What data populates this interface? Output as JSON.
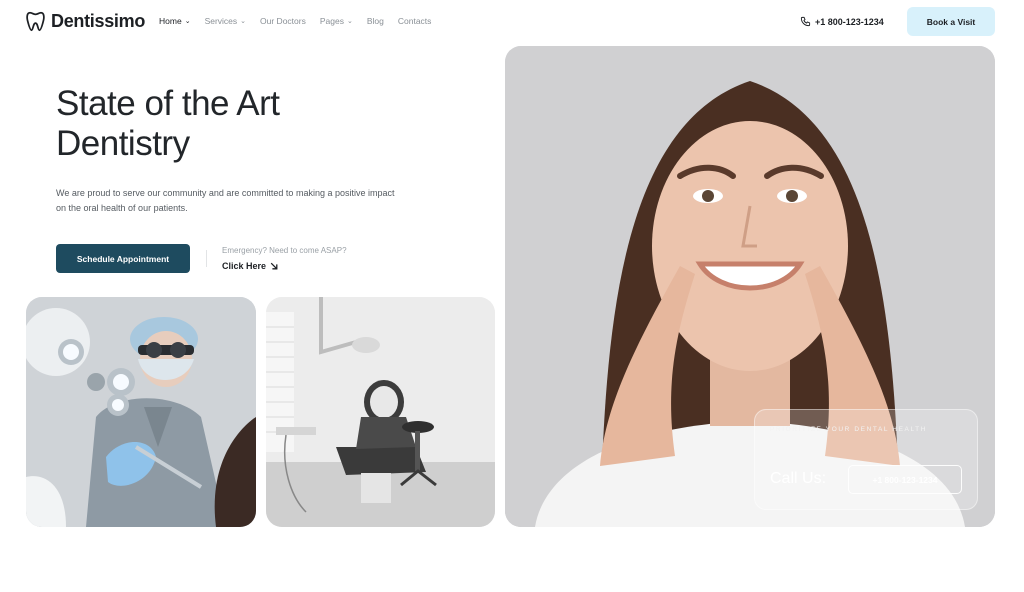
{
  "brand": {
    "name": "Dentissimo",
    "logo_icon": "tooth-icon"
  },
  "nav": {
    "items": [
      {
        "label": "Home",
        "active": true,
        "dropdown": true
      },
      {
        "label": "Services",
        "active": false,
        "dropdown": true
      },
      {
        "label": "Our Doctors",
        "active": false,
        "dropdown": false
      },
      {
        "label": "Pages",
        "active": false,
        "dropdown": true
      },
      {
        "label": "Blog",
        "active": false,
        "dropdown": false
      },
      {
        "label": "Contacts",
        "active": false,
        "dropdown": false
      }
    ]
  },
  "header": {
    "phone": "+1 800-123-1234",
    "phone_icon": "phone-icon",
    "book_label": "Book a Visit"
  },
  "hero": {
    "title_line1": "State of the Art",
    "title_line2": "Dentistry",
    "description": "We are proud to serve our community and are committed to making a positive impact on the oral health of our patients.",
    "cta_label": "Schedule Appointment",
    "emergency_text": "Emergency? Need to come ASAP?",
    "click_here_label": "Click Here",
    "click_here_icon": "arrow-down-right-icon"
  },
  "callout": {
    "tag": "PRIORITIZE YOUR DENTAL HEALTH",
    "label": "Call Us:",
    "phone": "+1 800-123-1234"
  },
  "colors": {
    "accent_dark": "#1e4b5f",
    "book_button_bg": "#d8f1fb",
    "text_dark": "#1d2024",
    "text_muted": "#8a9096"
  }
}
